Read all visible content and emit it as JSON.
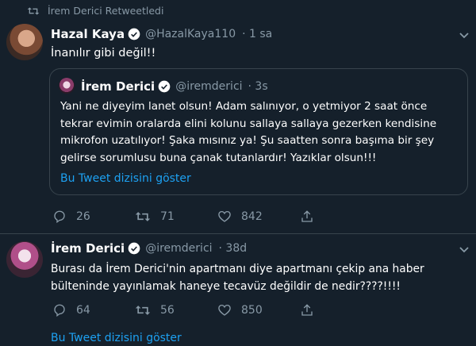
{
  "retweet_banner": {
    "text": "İrem Derici Retweetledi",
    "icon": "retweet-icon"
  },
  "tweet1": {
    "author_name": "Hazal Kaya",
    "handle": "@HazalKaya110",
    "time": "· 1 sa",
    "text": "İnanılır gibi değil!!",
    "quote": {
      "author_name": "İrem Derici",
      "handle": "@iremderici",
      "time": "· 3s",
      "text": "Yani ne diyeyim lanet olsun! Adam salınıyor, o yetmiyor 2 saat önce tekrar evimin oralarda elini kolunu sallaya sallaya gezerken kendisine mikrofon uzatılıyor! Şaka mısınız ya! Şu saatten sonra başıma bir şey gelirse sorumlusu buna çanak tutanlardır! Yazıklar olsun!!!",
      "show_thread": "Bu Tweet dizisini göster"
    },
    "actions": {
      "replies": "26",
      "retweets": "71",
      "likes": "842"
    }
  },
  "tweet2": {
    "author_name": "İrem Derici",
    "handle": "@iremderici",
    "time": "· 38d",
    "text": "Burası da İrem Derici'nin apartmanı diye apartmanı çekip ana haber bülteninde yayınlamak haneye tecavüz değildir de nedir????!!!!",
    "actions": {
      "replies": "64",
      "retweets": "56",
      "likes": "850"
    },
    "show_thread": "Bu Tweet dizisini göster"
  },
  "colors": {
    "background": "#15202b",
    "accent": "#1da1f2",
    "secondary_text": "#8899a6",
    "border": "#38444d"
  }
}
